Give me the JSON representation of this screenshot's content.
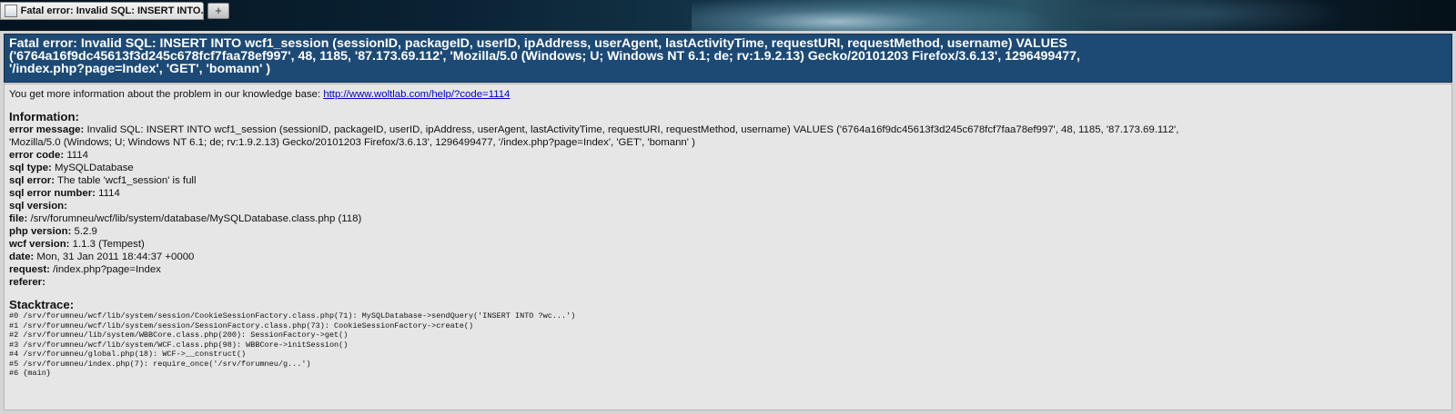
{
  "browser": {
    "tab_title": "Fatal error: Invalid SQL: INSERT INTO...",
    "new_tab_label": "+",
    "icons": [
      "page-icon"
    ]
  },
  "header": {
    "lines": [
      "Fatal error: Invalid SQL: INSERT INTO wcf1_session (sessionID, packageID, userID, ipAddress, userAgent, lastActivityTime, requestURI, requestMethod, username) VALUES",
      "('6764a16f9dc45613f3d245c678fcf7faa78ef997', 48, 1185, '87.173.69.112', 'Mozilla/5.0 (Windows; U; Windows NT 6.1; de; rv:1.9.2.13) Gecko/20101203 Firefox/3.6.13', 1296499477,",
      "'/index.php?page=Index', 'GET', 'bomann' )"
    ],
    "bg_color": "#1d4a75"
  },
  "knowledge": {
    "text": "You get more information about the problem in our knowledge base: ",
    "link": "http://www.woltlab.com/help/?code=1114"
  },
  "information": {
    "title": "Information:",
    "error_message_label": "error message:",
    "error_message_line1": "Invalid SQL: INSERT INTO wcf1_session (sessionID, packageID, userID, ipAddress, userAgent, lastActivityTime, requestURI, requestMethod, username) VALUES ('6764a16f9dc45613f3d245c678fcf7faa78ef997', 48, 1185, '87.173.69.112',",
    "error_message_line2": "'Mozilla/5.0 (Windows; U; Windows NT 6.1; de; rv:1.9.2.13) Gecko/20101203 Firefox/3.6.13', 1296499477, '/index.php?page=Index', 'GET', 'bomann' )",
    "rows": [
      {
        "label": "error code:",
        "value": "1114"
      },
      {
        "label": "sql type:",
        "value": "MySQLDatabase"
      },
      {
        "label": "sql error:",
        "value": "The table 'wcf1_session' is full"
      },
      {
        "label": "sql error number:",
        "value": "1114"
      },
      {
        "label": "sql version:",
        "value": ""
      },
      {
        "label": "file:",
        "value": "/srv/forumneu/wcf/lib/system/database/MySQLDatabase.class.php (118)"
      },
      {
        "label": "php version:",
        "value": "5.2.9"
      },
      {
        "label": "wcf version:",
        "value": "1.1.3 (Tempest)"
      },
      {
        "label": "date:",
        "value": "Mon, 31 Jan 2011 18:44:37 +0000"
      },
      {
        "label": "request:",
        "value": "/index.php?page=Index"
      },
      {
        "label": "referer:",
        "value": ""
      }
    ]
  },
  "stacktrace": {
    "title": "Stacktrace:",
    "lines": [
      "#0 /srv/forumneu/wcf/lib/system/session/CookieSessionFactory.class.php(71): MySQLDatabase->sendQuery('INSERT INTO ?wc...')",
      "#1 /srv/forumneu/wcf/lib/system/session/SessionFactory.class.php(73): CookieSessionFactory->create()",
      "#2 /srv/forumneu/lib/system/WBBCore.class.php(200): SessionFactory->get()",
      "#3 /srv/forumneu/wcf/lib/system/WCF.class.php(98): WBBCore->initSession()",
      "#4 /srv/forumneu/global.php(18): WCF->__construct()",
      "#5 /srv/forumneu/index.php(7): require_once('/srv/forumneu/g...')",
      "#6 {main}"
    ]
  }
}
